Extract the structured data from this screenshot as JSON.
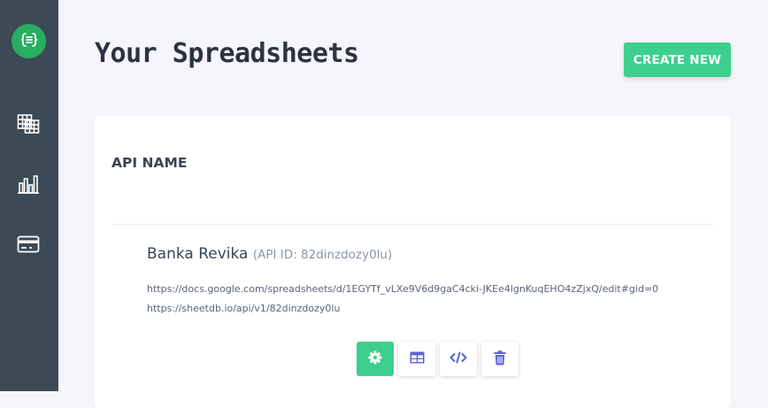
{
  "sidebar": {
    "logo_icon": "api-braces-icon",
    "items": [
      {
        "name": "spreadsheets",
        "icon": "table-grid-icon"
      },
      {
        "name": "analytics",
        "icon": "bar-chart-icon"
      },
      {
        "name": "billing",
        "icon": "credit-card-icon"
      }
    ]
  },
  "header": {
    "title": "Your Spreadsheets",
    "create_label": "CREATE NEW"
  },
  "table": {
    "column_header": "API NAME",
    "rows": [
      {
        "name": "Banka Revika",
        "api_id_text": "(API ID: 82dinzdozy0lu)",
        "spreadsheet_url": "https://docs.google.com/spreadsheets/d/1EGYTf_vLXe9V6d9gaC4cki-JKEe4lgnKuqEHO4zZjxQ/edit#gid=0",
        "api_url": "https://sheetdb.io/api/v1/82dinzdozy0lu",
        "actions": [
          {
            "name": "settings",
            "icon": "gear-icon"
          },
          {
            "name": "view-table",
            "icon": "table-icon"
          },
          {
            "name": "code",
            "icon": "code-icon"
          },
          {
            "name": "delete",
            "icon": "trash-icon"
          }
        ]
      }
    ]
  },
  "colors": {
    "sidebar_bg": "#3b4a54",
    "accent_green": "#3ecf8e",
    "logo_green": "#27ae60",
    "action_icon": "#5b63d3",
    "page_bg": "#f5f5fb"
  }
}
